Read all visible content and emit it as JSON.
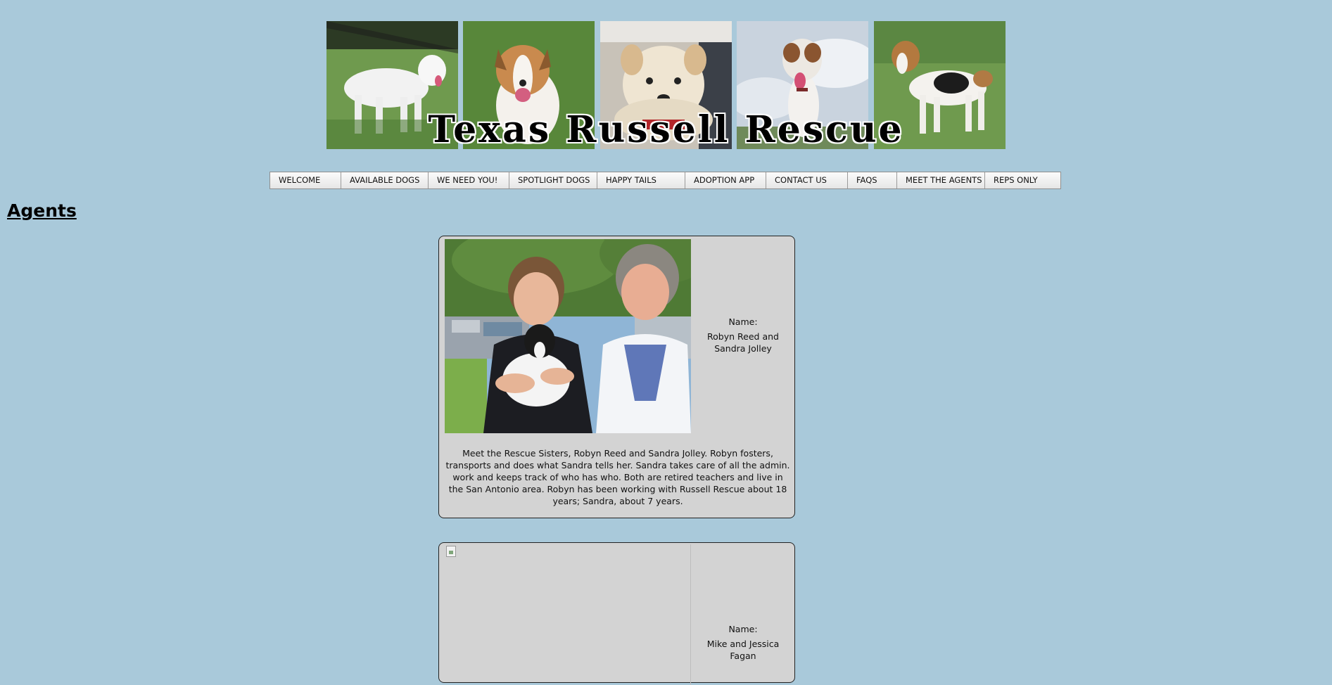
{
  "header": {
    "title": "Texas Russell Rescue",
    "photos": [
      "dog-photo-1",
      "dog-photo-2",
      "dog-photo-3",
      "dog-photo-4",
      "dog-photo-5"
    ]
  },
  "nav": {
    "items": [
      "WELCOME",
      "AVAILABLE DOGS",
      "WE NEED YOU!",
      "SPOTLIGHT DOGS",
      "HAPPY TAILS",
      "ADOPTION APP",
      "CONTACT US",
      "FAQS",
      "MEET THE AGENTS",
      "REPS ONLY"
    ]
  },
  "page": {
    "title": "Agents"
  },
  "agents": [
    {
      "name_label": "Name:",
      "name": "Robyn Reed and Sandra Jolley",
      "description": "Meet the Rescue Sisters, Robyn Reed and Sandra Jolley. Robyn fosters, transports and does what Sandra tells her. Sandra takes care of all the admin. work and keeps track of who has who. Both are retired teachers and live in the San Antonio area. Robyn has been working with Russell Rescue about 18 years; Sandra, about 7 years."
    },
    {
      "name_label": "Name:",
      "name": "Mike and Jessica Fagan"
    }
  ],
  "colors": {
    "background": "#a9c9da",
    "card": "#d3d3d3"
  }
}
